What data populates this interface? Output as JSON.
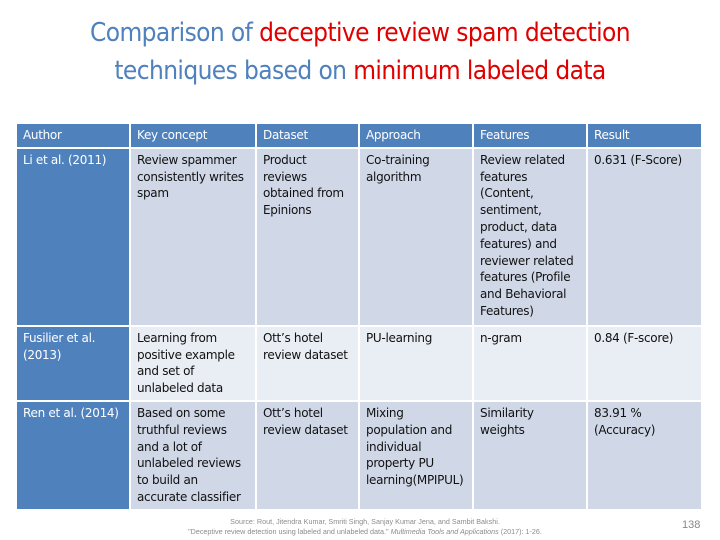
{
  "slide": {
    "title": {
      "line1": [
        {
          "text": "Comparison of ",
          "highlight": false
        },
        {
          "text": "deceptive review spam detection",
          "highlight": true
        }
      ],
      "line2": [
        {
          "text": "techniques based on ",
          "highlight": false
        },
        {
          "text": "minimum labeled data",
          "highlight": true
        }
      ]
    },
    "colors": {
      "title_blue": "#4f81bd",
      "title_red": "#e00000",
      "header_bg": "#4f81bd",
      "row_dark_bg": "#d0d8e8",
      "row_light_bg": "#e9edf4"
    },
    "table": {
      "headers": [
        "Author",
        "Key concept",
        "Dataset",
        "Approach",
        "Features",
        "Result"
      ],
      "rows": [
        {
          "author": "Li et al. (2011)",
          "key_concept": "Review spammer consistently writes spam",
          "dataset": "Product reviews obtained from Epinions",
          "approach": "Co-training algorithm",
          "features": "Review related features (Content, sentiment, product, data features) and reviewer related features (Profile and Behavioral Features)",
          "result": "0.631 (F-Score)"
        },
        {
          "author": "Fusilier et al. (2013)",
          "key_concept": "Learning from positive example and set of unlabeled data",
          "dataset": "Ott’s hotel review dataset",
          "approach": "PU-learning",
          "features": "n-gram",
          "result": "0.84 (F-score)"
        },
        {
          "author": "Ren et al. (2014)",
          "key_concept": "Based on some truthful reviews and a lot of unlabeled reviews to build an accurate classifier",
          "dataset": "Ott’s hotel review dataset",
          "approach": "Mixing population and individual property PU learning(MPIPUL)",
          "features": "Similarity weights",
          "result": "83.91 % (Accuracy)"
        }
      ]
    },
    "source": {
      "line1": "Source: Rout, Jitendra Kumar, Smriti Singh, Sanjay Kumar Jena, and Sambit Bakshi.",
      "line2_prefix": "\"Deceptive review detection using labeled and unlabeled data.\" ",
      "line2_journal": "Multimedia Tools and Applications",
      "line2_suffix": " (2017): 1-26."
    },
    "page_number": "138"
  }
}
